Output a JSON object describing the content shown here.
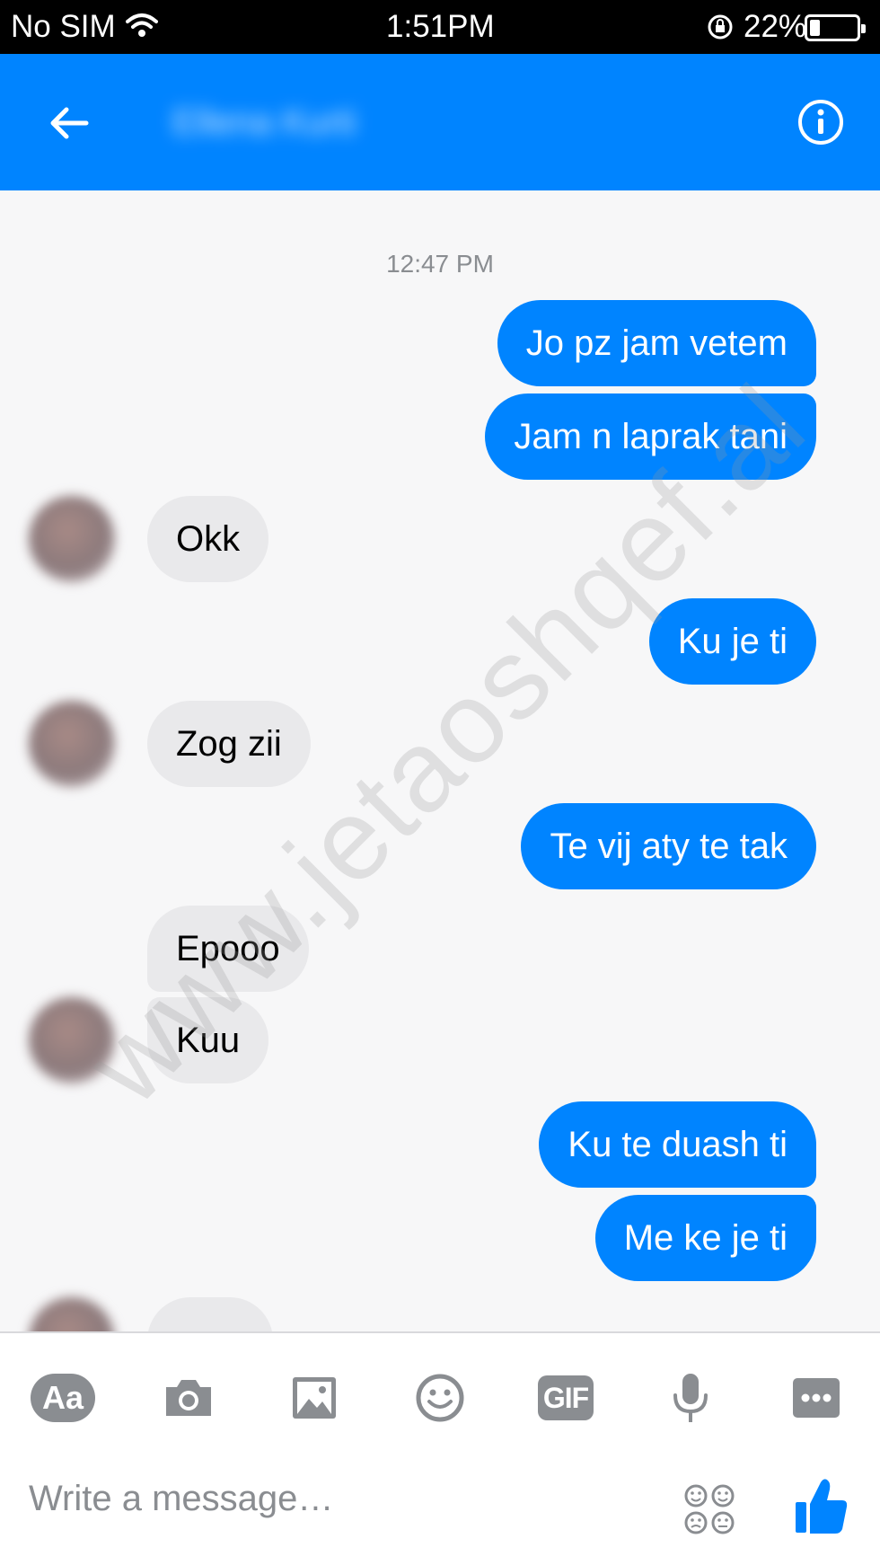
{
  "status_bar": {
    "carrier": "No SIM",
    "time": "1:51PM",
    "battery_percent": "22%",
    "battery_level": 0.22
  },
  "header": {
    "contact_name": "Ellena Kurti"
  },
  "chat": {
    "timestamp": "12:47 PM",
    "messages": [
      {
        "from": "me",
        "text": "Jo pz jam vetem"
      },
      {
        "from": "me",
        "text": "Jam n laprak tani"
      },
      {
        "from": "them",
        "text": "Okk"
      },
      {
        "from": "me",
        "text": "Ku je ti"
      },
      {
        "from": "them",
        "text": "Zog zii"
      },
      {
        "from": "me",
        "text": "Te vij aty te tak"
      },
      {
        "from": "them",
        "text": "Epooo"
      },
      {
        "from": "them",
        "text": "Kuu"
      },
      {
        "from": "me",
        "text": "Ku te duash ti"
      },
      {
        "from": "me",
        "text": "Me ke je ti"
      }
    ]
  },
  "watermark": "www.jetaoshqef.al",
  "toolbar": {
    "aa_label": "Aa",
    "gif_label": "GIF"
  },
  "composer": {
    "placeholder": "Write a message…"
  },
  "colors": {
    "accent": "#0084ff",
    "incoming_bubble": "#e9e9eb",
    "icon_gray": "#8a8d91"
  }
}
